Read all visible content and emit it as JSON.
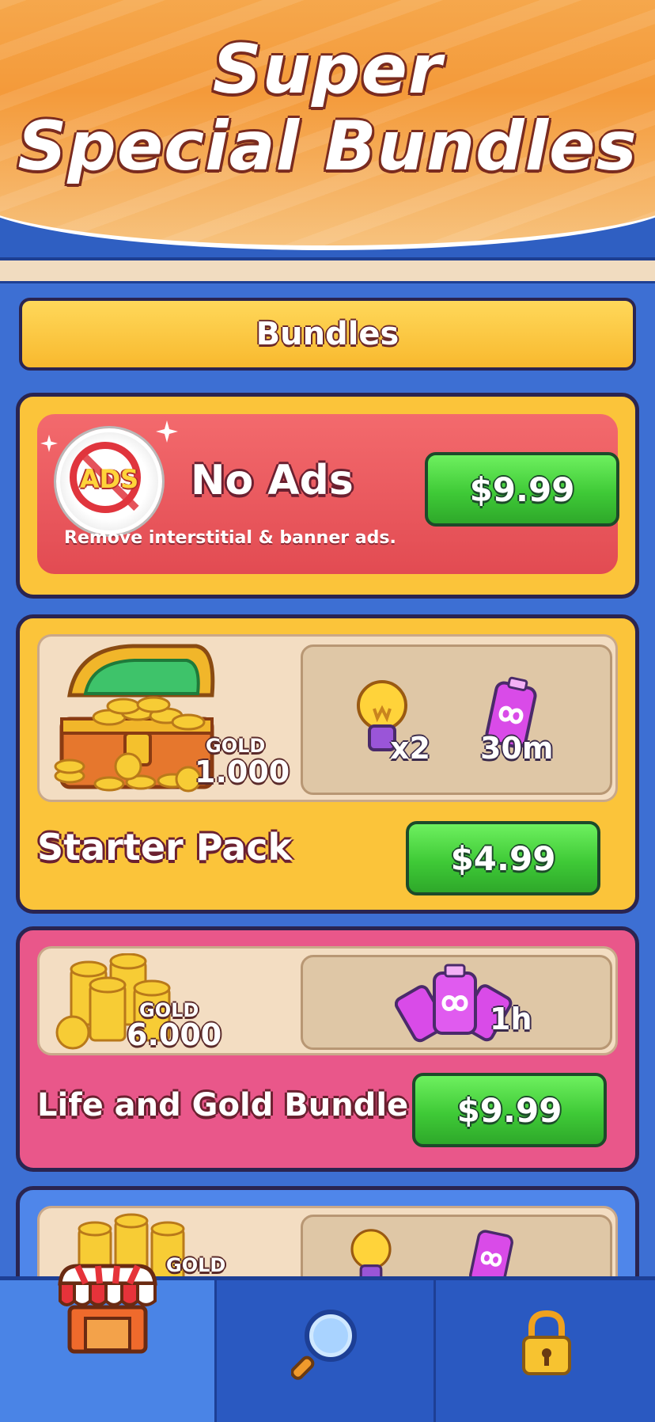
{
  "header": {
    "title_line1": "Super",
    "title_line2": "Special Bundles"
  },
  "section": {
    "label": "Bundles"
  },
  "bundles": [
    {
      "id": "no-ads",
      "icon_text": "ADS",
      "title": "No Ads",
      "description": "Remove interstitial & banner ads.",
      "price": "$9.99"
    },
    {
      "id": "starter-pack",
      "title": "Starter Pack",
      "gold_label": "GOLD",
      "gold_amount": "1.000",
      "items": [
        {
          "icon": "lightbulb-hint-icon",
          "label": "x2"
        },
        {
          "icon": "infinite-life-battery-icon",
          "label": "30m"
        }
      ],
      "price": "$4.99"
    },
    {
      "id": "life-and-gold",
      "title": "Life and Gold Bundle",
      "gold_label": "GOLD",
      "gold_amount": "6.000",
      "items": [
        {
          "icon": "infinite-life-batteries-icon",
          "label": "1h"
        }
      ],
      "price": "$9.99"
    },
    {
      "id": "partial-bundle",
      "gold_label": "GOLD"
    }
  ],
  "tabs": [
    {
      "icon": "shop-icon",
      "active": true
    },
    {
      "icon": "magnifier-icon",
      "active": false
    },
    {
      "icon": "lock-icon",
      "active": false
    }
  ],
  "colors": {
    "background_blue": "#2f5fc2",
    "card_yellow": "#fbc43a",
    "card_pink": "#e9578a",
    "no_ads_red": "#e24b52",
    "buy_green": "#3fca37"
  }
}
